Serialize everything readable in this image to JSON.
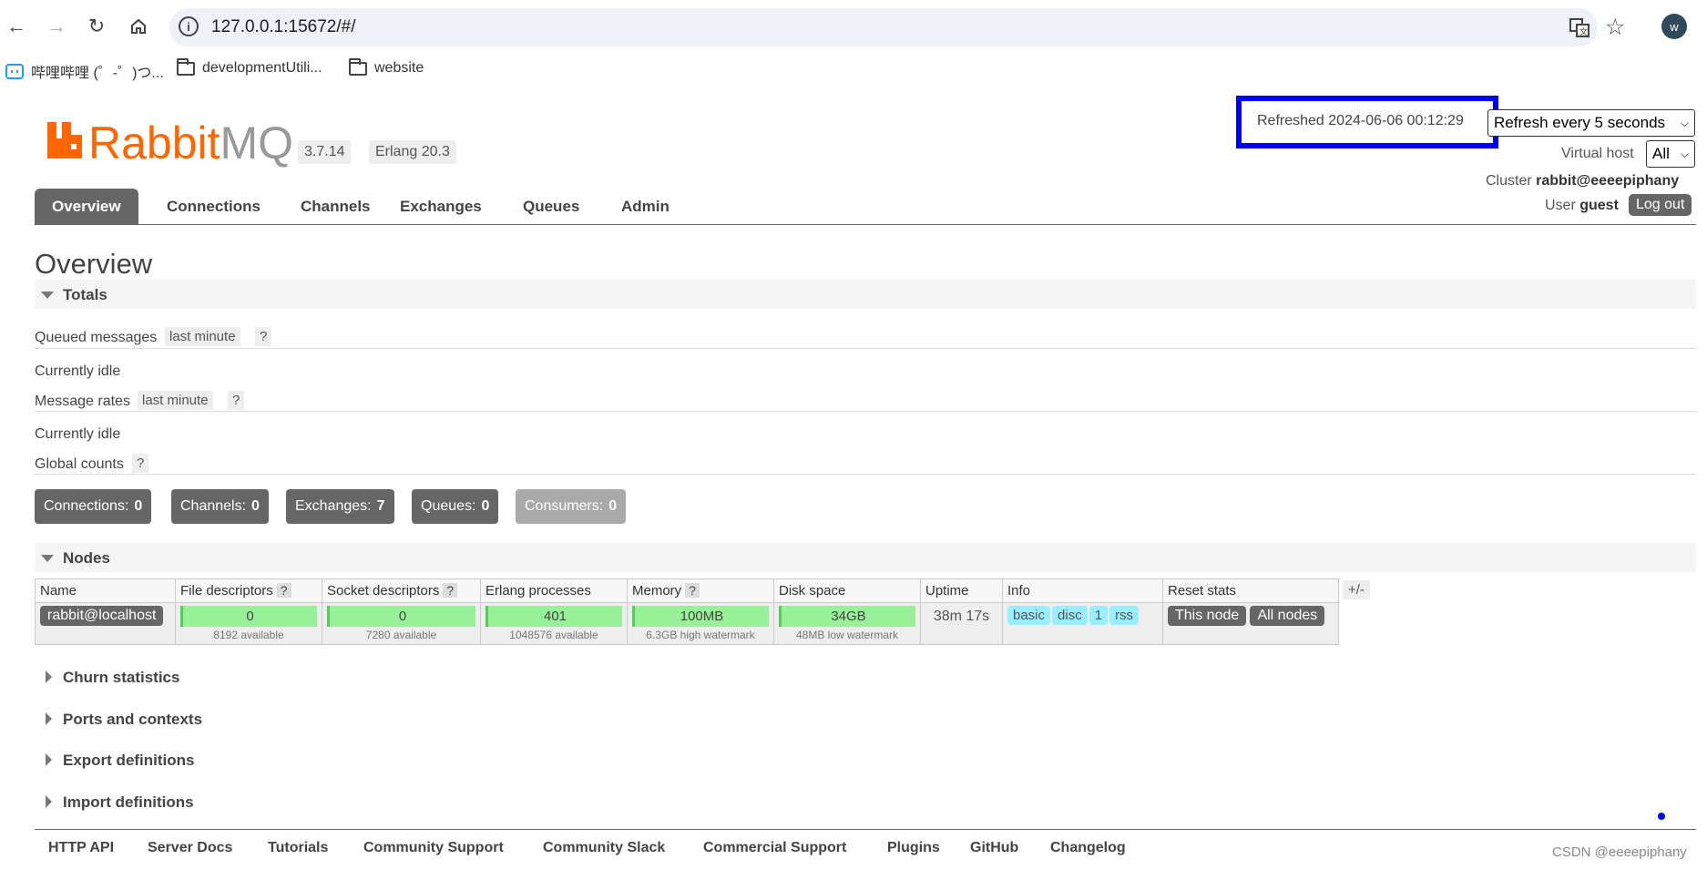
{
  "browser": {
    "url": "127.0.0.1:15672/#/",
    "avatar_letter": "w",
    "bookmarks": [
      "哔哩哔哩 (゜-゜)つ...",
      "developmentUtili...",
      "website"
    ]
  },
  "header": {
    "logo_rabbit": "Rabbit",
    "logo_mq": "MQ",
    "version": "3.7.14",
    "erlang": "Erlang 20.3",
    "refreshed": "Refreshed 2024-06-06 00:12:29",
    "refresh_select": "Refresh every 5 seconds",
    "virtual_host_label": "Virtual host",
    "virtual_host_value": "All",
    "cluster_label": "Cluster",
    "cluster_value": "rabbit@eeeepiphany",
    "user_label": "User",
    "user_value": "guest",
    "logout": "Log out"
  },
  "tabs": [
    "Overview",
    "Connections",
    "Channels",
    "Exchanges",
    "Queues",
    "Admin"
  ],
  "page_title": "Overview",
  "totals": {
    "title": "Totals",
    "queued_label": "Queued messages",
    "queued_range": "last minute",
    "q": "?",
    "idle1": "Currently idle",
    "rates_label": "Message rates",
    "rates_range": "last minute",
    "idle2": "Currently idle",
    "global_label": "Global counts",
    "counters": [
      {
        "label": "Connections:",
        "value": "0"
      },
      {
        "label": "Channels:",
        "value": "0"
      },
      {
        "label": "Exchanges:",
        "value": "7"
      },
      {
        "label": "Queues:",
        "value": "0"
      },
      {
        "label": "Consumers:",
        "value": "0"
      }
    ]
  },
  "nodes": {
    "title": "Nodes",
    "headers": [
      "Name",
      "File descriptors",
      "Socket descriptors",
      "Erlang processes",
      "Memory",
      "Disk space",
      "Uptime",
      "Info",
      "Reset stats"
    ],
    "plus_minus": "+/-",
    "row": {
      "name": "rabbit@localhost",
      "fd": "0",
      "fd_sub": "8192 available",
      "sd": "0",
      "sd_sub": "7280 available",
      "ep": "401",
      "ep_sub": "1048576 available",
      "mem": "100MB",
      "mem_sub": "6.3GB high watermark",
      "disk": "34GB",
      "disk_sub": "48MB low watermark",
      "uptime": "38m 17s",
      "info": [
        "basic",
        "disc",
        "1",
        "rss"
      ],
      "reset_this": "This node",
      "reset_all": "All nodes"
    }
  },
  "collapsed_sections": [
    "Churn statistics",
    "Ports and contexts",
    "Export definitions",
    "Import definitions"
  ],
  "footer": {
    "links": [
      "HTTP API",
      "Server Docs",
      "Tutorials",
      "Community Support",
      "Community Slack",
      "Commercial Support",
      "Plugins",
      "GitHub",
      "Changelog"
    ],
    "watermark": "CSDN @eeeepiphany"
  }
}
